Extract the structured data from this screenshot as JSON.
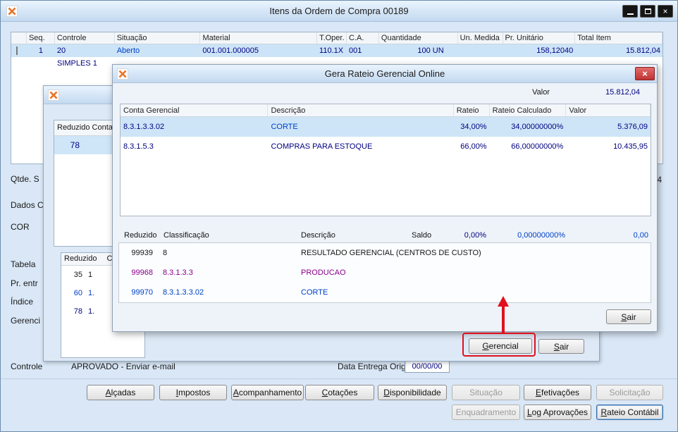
{
  "window": {
    "title": "Itens da Ordem de Compra 00189"
  },
  "items_grid": {
    "headers": {
      "seq": "Seq.",
      "controle": "Controle",
      "situacao": "Situação",
      "material": "Material",
      "t_oper": "T.Oper.",
      "ca": "C.A.",
      "quantidade": "Quantidade",
      "un_medida": "Un. Medida",
      "pr_unitario": "Pr. Unitário",
      "total_item": "Total Item"
    },
    "row1": {
      "seq": "1",
      "controle": "20",
      "controle_line2": "SIMPLES 1",
      "situacao": "Aberto",
      "material": "001.001.000005",
      "t_oper": "110.1X",
      "ca": "001",
      "quantidade": "100 UN",
      "pr_unitario": "158,12040",
      "total_item": "15.812,04"
    },
    "fragment_right": "4"
  },
  "form_labels": {
    "qtde": "Qtde. S",
    "dados": "Dados C",
    "cor": "COR",
    "tabela": "Tabela",
    "pr_entr": "Pr. entr",
    "indice": "Índice",
    "gerencial": "Gerenci",
    "controle": "Controle",
    "controle_value": "APROVADO - Enviar e-mail",
    "data_entrega_label": "Data Entrega Original",
    "data_entrega_value": "00/00/00"
  },
  "dialog2": {
    "grid1_header": "Reduzido Conta",
    "grid1_selected": "78",
    "grid2_header_reduzido": "Reduzido",
    "grid2_header_cla": "Cla",
    "grid2_rows": [
      {
        "reduzido": "35",
        "cla": "1"
      },
      {
        "reduzido": "60",
        "cla": "1."
      },
      {
        "reduzido": "78",
        "cla": "1."
      }
    ],
    "gerencial_button": "Gerencial",
    "sair_button": "Sair"
  },
  "modal": {
    "title": "Gera Rateio Gerencial Online",
    "valor_label": "Valor",
    "valor_value": "15.812,04",
    "grid": {
      "headers": {
        "conta": "Conta Gerencial",
        "descricao": "Descrição",
        "rateio": "Rateio",
        "rateio_calc": "Rateio Calculado",
        "valor": "Valor"
      },
      "rows": [
        {
          "conta": "8.3.1.3.3.02",
          "descricao": "CORTE",
          "rateio": "34,00%",
          "rateio_calc": "34,00000000%",
          "valor": "5.376,09"
        },
        {
          "conta": "8.3.1.5.3",
          "descricao": "COMPRAS PARA ESTOQUE",
          "rateio": "66,00%",
          "rateio_calc": "66,00000000%",
          "valor": "10.435,95"
        }
      ]
    },
    "summary": {
      "reduzido": "Reduzido",
      "classificacao": "Classificação",
      "descricao": "Descrição",
      "saldo": "Saldo",
      "pct": "0,00%",
      "pct_calc": "0,00000000%",
      "valor": "0,00"
    },
    "accounts": [
      {
        "reduzido": "99939",
        "classificacao": "8",
        "descricao": "RESULTADO GERENCIAL (CENTROS DE CUSTO)"
      },
      {
        "reduzido": "99968",
        "classificacao": "8.3.1.3.3",
        "descricao": "PRODUCAO"
      },
      {
        "reduzido": "99970",
        "classificacao": "8.3.1.3.3.02",
        "descricao": "CORTE"
      }
    ],
    "sair_button": "Sair"
  },
  "bottom_buttons": {
    "alcadas": "Alçadas",
    "impostos": "Impostos",
    "acompanhamento": "Acompanhamento",
    "cotacoes": "Cotações",
    "disponibilidade": "Disponibilidade",
    "situacao": "Situação",
    "efetivacoes": "Efetivações",
    "solicitacao": "Solicitação",
    "enquadramento": "Enquadramento",
    "log_aprovacoes": "Log Aprovações",
    "rateio_contabil": "Rateio Contábil"
  },
  "colors": {
    "navy_value_text": "#000080",
    "blue_value_text": "#0040c8",
    "purple_account_text": "#8B008B",
    "orange_status_text": "#C45911",
    "selection_row": "#CCE4F7",
    "annotation_red": "#E0101D"
  }
}
